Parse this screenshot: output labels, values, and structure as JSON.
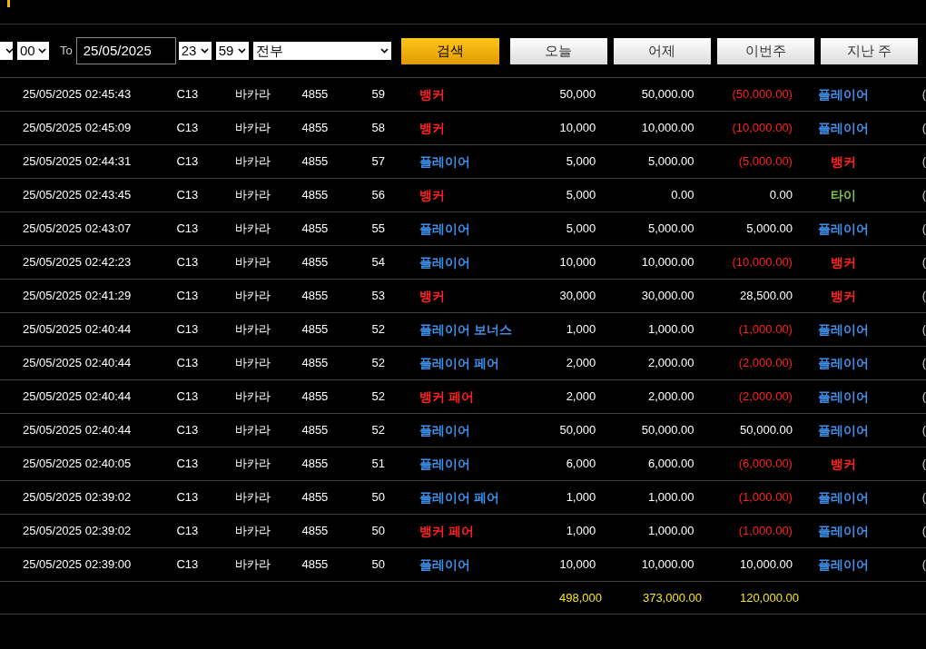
{
  "filters": {
    "from_minute": "00",
    "to_label": "To",
    "to_date": "25/05/2025",
    "to_hour": "23",
    "to_minute": "59",
    "bet_type": "전부",
    "search_button": "검색",
    "quick_buttons": [
      "오늘",
      "어제",
      "이번주",
      "지난 주"
    ]
  },
  "rows": [
    {
      "time": "25/05/2025 02:45:43",
      "table": "C13",
      "game": "바카라",
      "shoe": "4855",
      "round": "59",
      "bet": {
        "text": "뱅커",
        "color": "#ff2020"
      },
      "amount": "50,000",
      "valid": "50,000.00",
      "result": "(50,000.00)",
      "loss": true,
      "winner": {
        "text": "플레이어",
        "color": "#3d8fe8"
      },
      "column_10": "("
    },
    {
      "time": "25/05/2025 02:45:09",
      "table": "C13",
      "game": "바카라",
      "shoe": "4855",
      "round": "58",
      "bet": {
        "text": "뱅커",
        "color": "#ff2020"
      },
      "amount": "10,000",
      "valid": "10,000.00",
      "result": "(10,000.00)",
      "loss": true,
      "winner": {
        "text": "플레이어",
        "color": "#3d8fe8"
      },
      "column_10": "("
    },
    {
      "time": "25/05/2025 02:44:31",
      "table": "C13",
      "game": "바카라",
      "shoe": "4855",
      "round": "57",
      "bet": {
        "text": "플레이어",
        "color": "#3d8fe8"
      },
      "amount": "5,000",
      "valid": "5,000.00",
      "result": "(5,000.00)",
      "loss": true,
      "winner": {
        "text": "뱅커",
        "color": "#ff2020"
      },
      "column_10": "("
    },
    {
      "time": "25/05/2025 02:43:45",
      "table": "C13",
      "game": "바카라",
      "shoe": "4855",
      "round": "56",
      "bet": {
        "text": "뱅커",
        "color": "#ff2020"
      },
      "amount": "5,000",
      "valid": "0.00",
      "result": "0.00",
      "loss": false,
      "winner": {
        "text": "타이",
        "color": "#7dc242"
      },
      "column_10": "("
    },
    {
      "time": "25/05/2025 02:43:07",
      "table": "C13",
      "game": "바카라",
      "shoe": "4855",
      "round": "55",
      "bet": {
        "text": "플레이어",
        "color": "#3d8fe8"
      },
      "amount": "5,000",
      "valid": "5,000.00",
      "result": "5,000.00",
      "loss": false,
      "winner": {
        "text": "플레이어",
        "color": "#3d8fe8"
      },
      "column_10": "("
    },
    {
      "time": "25/05/2025 02:42:23",
      "table": "C13",
      "game": "바카라",
      "shoe": "4855",
      "round": "54",
      "bet": {
        "text": "플레이어",
        "color": "#3d8fe8"
      },
      "amount": "10,000",
      "valid": "10,000.00",
      "result": "(10,000.00)",
      "loss": true,
      "winner": {
        "text": "뱅커",
        "color": "#ff2020"
      },
      "column_10": "("
    },
    {
      "time": "25/05/2025 02:41:29",
      "table": "C13",
      "game": "바카라",
      "shoe": "4855",
      "round": "53",
      "bet": {
        "text": "뱅커",
        "color": "#ff2020"
      },
      "amount": "30,000",
      "valid": "30,000.00",
      "result": "28,500.00",
      "loss": false,
      "winner": {
        "text": "뱅커",
        "color": "#ff2020"
      },
      "column_10": "("
    },
    {
      "time": "25/05/2025 02:40:44",
      "table": "C13",
      "game": "바카라",
      "shoe": "4855",
      "round": "52",
      "bet": {
        "text": "플레이어 보너스",
        "color": "#3d8fe8"
      },
      "amount": "1,000",
      "valid": "1,000.00",
      "result": "(1,000.00)",
      "loss": true,
      "winner": {
        "text": "플레이어",
        "color": "#3d8fe8"
      },
      "column_10": "("
    },
    {
      "time": "25/05/2025 02:40:44",
      "table": "C13",
      "game": "바카라",
      "shoe": "4855",
      "round": "52",
      "bet": {
        "text": "플레이어 페어",
        "color": "#3d8fe8"
      },
      "amount": "2,000",
      "valid": "2,000.00",
      "result": "(2,000.00)",
      "loss": true,
      "winner": {
        "text": "플레이어",
        "color": "#3d8fe8"
      },
      "column_10": "("
    },
    {
      "time": "25/05/2025 02:40:44",
      "table": "C13",
      "game": "바카라",
      "shoe": "4855",
      "round": "52",
      "bet": {
        "text": "뱅커 페어",
        "color": "#ff2020"
      },
      "amount": "2,000",
      "valid": "2,000.00",
      "result": "(2,000.00)",
      "loss": true,
      "winner": {
        "text": "플레이어",
        "color": "#3d8fe8"
      },
      "column_10": "("
    },
    {
      "time": "25/05/2025 02:40:44",
      "table": "C13",
      "game": "바카라",
      "shoe": "4855",
      "round": "52",
      "bet": {
        "text": "플레이어",
        "color": "#3d8fe8"
      },
      "amount": "50,000",
      "valid": "50,000.00",
      "result": "50,000.00",
      "loss": false,
      "winner": {
        "text": "플레이어",
        "color": "#3d8fe8"
      },
      "column_10": "("
    },
    {
      "time": "25/05/2025 02:40:05",
      "table": "C13",
      "game": "바카라",
      "shoe": "4855",
      "round": "51",
      "bet": {
        "text": "플레이어",
        "color": "#3d8fe8"
      },
      "amount": "6,000",
      "valid": "6,000.00",
      "result": "(6,000.00)",
      "loss": true,
      "winner": {
        "text": "뱅커",
        "color": "#ff2020"
      },
      "column_10": "("
    },
    {
      "time": "25/05/2025 02:39:02",
      "table": "C13",
      "game": "바카라",
      "shoe": "4855",
      "round": "50",
      "bet": {
        "text": "플레이어 페어",
        "color": "#3d8fe8"
      },
      "amount": "1,000",
      "valid": "1,000.00",
      "result": "(1,000.00)",
      "loss": true,
      "winner": {
        "text": "플레이어",
        "color": "#3d8fe8"
      },
      "column_10": "("
    },
    {
      "time": "25/05/2025 02:39:02",
      "table": "C13",
      "game": "바카라",
      "shoe": "4855",
      "round": "50",
      "bet": {
        "text": "뱅커 페어",
        "color": "#ff2020"
      },
      "amount": "1,000",
      "valid": "1,000.00",
      "result": "(1,000.00)",
      "loss": true,
      "winner": {
        "text": "플레이어",
        "color": "#3d8fe8"
      },
      "column_10": "("
    },
    {
      "time": "25/05/2025 02:39:00",
      "table": "C13",
      "game": "바카라",
      "shoe": "4855",
      "round": "50",
      "bet": {
        "text": "플레이어",
        "color": "#3d8fe8"
      },
      "amount": "10,000",
      "valid": "10,000.00",
      "result": "10,000.00",
      "loss": false,
      "winner": {
        "text": "플레이어",
        "color": "#3d8fe8"
      },
      "column_10": "("
    }
  ],
  "totals": {
    "amount": "498,000",
    "valid": "373,000.00",
    "result": "120,000.00"
  }
}
